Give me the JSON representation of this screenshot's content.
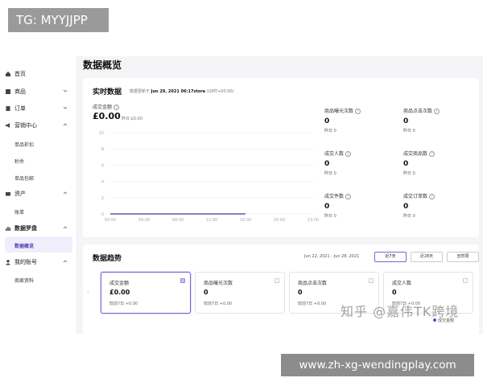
{
  "overlay": {
    "tag": "TG: MYYJJPP",
    "url": "www.zh-xg-wendingplay.com",
    "watermark": "知乎 @嘉伟TK跨境"
  },
  "sidebar": {
    "items": [
      {
        "label": "首页",
        "icon": "home-icon"
      },
      {
        "label": "商品",
        "icon": "grid-icon"
      },
      {
        "label": "订单",
        "icon": "receipt-icon"
      },
      {
        "label": "营销中心",
        "icon": "megaphone-icon"
      },
      {
        "label": "单品折扣",
        "icon": ""
      },
      {
        "label": "秒杀",
        "icon": ""
      },
      {
        "label": "单品包邮",
        "icon": ""
      },
      {
        "label": "资产",
        "icon": "wallet-icon"
      },
      {
        "label": "账单",
        "icon": ""
      },
      {
        "label": "数据罗盘",
        "icon": "bar-chart-icon"
      },
      {
        "label": "数据概览",
        "icon": ""
      },
      {
        "label": "我的账号",
        "icon": "user-icon"
      },
      {
        "label": "商家资料",
        "icon": ""
      }
    ]
  },
  "page": {
    "title": "数据概览"
  },
  "realtime": {
    "title": "实时数据",
    "update_prefix": "数据更新于",
    "update_time": "Jun 29, 2021 06:17store",
    "update_tz": "(GMT+00:00)",
    "gmv_label": "成交金额",
    "gmv_value": "£0.00",
    "gmv_yesterday": "昨日 £0.00",
    "metrics": [
      {
        "label": "商品曝光次数",
        "value": "0",
        "sub": "昨日 0"
      },
      {
        "label": "商品点击次数",
        "value": "0",
        "sub": "昨日 0"
      },
      {
        "label": "成交人数",
        "value": "0",
        "sub": "昨日 0"
      },
      {
        "label": "成交商品数",
        "value": "0",
        "sub": "昨日 0"
      },
      {
        "label": "成交件数",
        "value": "0",
        "sub": "昨日 0"
      },
      {
        "label": "成交订单数",
        "value": "0",
        "sub": "昨日 0"
      }
    ]
  },
  "chart_data": {
    "type": "line",
    "x": [
      "00:00",
      "04:00",
      "08:00",
      "12:00",
      "16:00",
      "20:00",
      "23:00"
    ],
    "yticks": [
      "10",
      "8",
      "6",
      "4",
      "2",
      "0"
    ],
    "ylim": [
      0,
      10
    ],
    "series": [
      {
        "values": [
          0,
          0,
          0,
          0,
          0
        ]
      }
    ],
    "grid": true,
    "line_color": "#6f4bb8"
  },
  "trend": {
    "title": "数据趋势",
    "date_range": "Jun 22, 2021 - Jun 28, 2021",
    "buttons": [
      "近7天",
      "近28天",
      "自然周"
    ],
    "cards": [
      {
        "label": "成交金额",
        "value": "£0.00",
        "sub": "较前7日 +0.00"
      },
      {
        "label": "商品曝光次数",
        "value": "0",
        "sub": "较前7日 +0.00"
      },
      {
        "label": "商品点击次数",
        "value": "0",
        "sub": "较前7日 +0.00"
      },
      {
        "label": "成交人数",
        "value": "0",
        "sub": "较前7日 +0.00"
      }
    ],
    "legend": "成交金额"
  }
}
